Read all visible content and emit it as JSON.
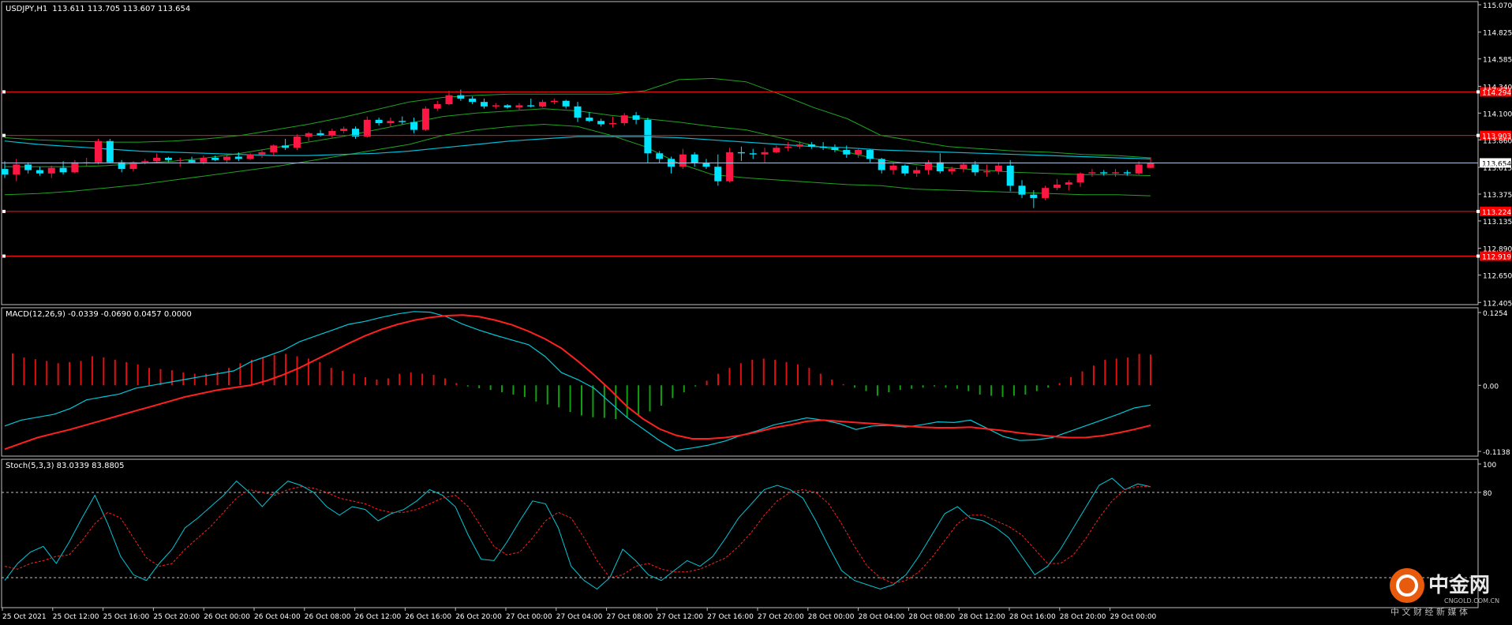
{
  "header": {
    "symbol": "USDJPY,H1",
    "ohlc": "113.611 113.705 113.607 113.654"
  },
  "indicators": {
    "macd_label": "MACD(12,26,9) -0.0339 -0.0690 0.0457 0.0000",
    "stoch_label": "Stoch(5,3,3) 83.0339 83.8805"
  },
  "colors": {
    "background": "#000000",
    "frame": "#c0c0c0",
    "bull_candle": "#ff1744",
    "bear_candle": "#00e5ff",
    "band": "#1fa31f",
    "ma": "#00bcd4",
    "level_line": "#ff1010",
    "price_line": "#b0c4de",
    "macd_main": "#00c8d8",
    "macd_signal": "#ff2020",
    "macd_hist_pos": "#e01010",
    "macd_hist_neg": "#10a010",
    "stoch_main": "#00c8d8",
    "stoch_signal": "#ff2020"
  },
  "chart_data": {
    "type": "candlestick",
    "symbol": "USDJPY",
    "timeframe": "H1",
    "price_axis": {
      "ticks": [
        "115.070",
        "114.825",
        "114.585",
        "114.340",
        "114.100",
        "113.860",
        "113.615",
        "113.375",
        "113.135",
        "112.890",
        "112.650",
        "112.405"
      ],
      "range": [
        112.4,
        115.07
      ],
      "current_price": "113.654"
    },
    "horizontal_levels": [
      {
        "price": 114.29,
        "label": "114.294"
      },
      {
        "price": 113.9,
        "label": "113.903"
      },
      {
        "price": 113.22,
        "label": "113.224"
      },
      {
        "price": 112.82,
        "label": "112.919"
      }
    ],
    "time_axis": [
      "25 Oct 2021",
      "25 Oct 12:00",
      "25 Oct 16:00",
      "25 Oct 20:00",
      "26 Oct 00:00",
      "26 Oct 04:00",
      "26 Oct 08:00",
      "26 Oct 12:00",
      "26 Oct 16:00",
      "26 Oct 20:00",
      "27 Oct 00:00",
      "27 Oct 04:00",
      "27 Oct 08:00",
      "27 Oct 12:00",
      "27 Oct 16:00",
      "27 Oct 20:00",
      "28 Oct 00:00",
      "28 Oct 04:00",
      "28 Oct 08:00",
      "28 Oct 12:00",
      "28 Oct 16:00",
      "28 Oct 20:00",
      "29 Oct 00:00"
    ],
    "candles": [
      [
        113.6,
        113.67,
        113.52,
        113.55
      ],
      [
        113.55,
        113.69,
        113.49,
        113.64
      ],
      [
        113.64,
        113.66,
        113.56,
        113.59
      ],
      [
        113.59,
        113.62,
        113.54,
        113.56
      ],
      [
        113.56,
        113.63,
        113.52,
        113.61
      ],
      [
        113.61,
        113.67,
        113.55,
        113.57
      ],
      [
        113.57,
        113.68,
        113.56,
        113.66
      ],
      [
        113.66,
        113.7,
        113.62,
        113.66
      ],
      [
        113.66,
        113.87,
        113.64,
        113.85
      ],
      [
        113.85,
        113.87,
        113.65,
        113.66
      ],
      [
        113.66,
        113.68,
        113.57,
        113.6
      ],
      [
        113.6,
        113.67,
        113.58,
        113.66
      ],
      [
        113.66,
        113.69,
        113.64,
        113.67
      ],
      [
        113.67,
        113.74,
        113.65,
        113.7
      ],
      [
        113.7,
        113.71,
        113.66,
        113.68
      ],
      [
        113.68,
        113.7,
        113.62,
        113.68
      ],
      [
        113.68,
        113.71,
        113.65,
        113.66
      ],
      [
        113.66,
        113.72,
        113.64,
        113.7
      ],
      [
        113.7,
        113.72,
        113.67,
        113.68
      ],
      [
        113.68,
        113.74,
        113.65,
        113.71
      ],
      [
        113.71,
        113.75,
        113.67,
        113.69
      ],
      [
        113.69,
        113.74,
        113.68,
        113.73
      ],
      [
        113.73,
        113.77,
        113.7,
        113.75
      ],
      [
        113.75,
        113.82,
        113.72,
        113.81
      ],
      [
        113.81,
        113.87,
        113.77,
        113.79
      ],
      [
        113.79,
        113.91,
        113.77,
        113.89
      ],
      [
        113.89,
        113.93,
        113.85,
        113.92
      ],
      [
        113.92,
        113.95,
        113.89,
        113.9
      ],
      [
        113.9,
        113.96,
        113.88,
        113.94
      ],
      [
        113.94,
        113.98,
        113.92,
        113.96
      ],
      [
        113.96,
        113.98,
        113.87,
        113.89
      ],
      [
        113.89,
        114.07,
        113.88,
        114.04
      ],
      [
        114.04,
        114.06,
        113.99,
        114.01
      ],
      [
        114.01,
        114.06,
        113.98,
        114.03
      ],
      [
        114.03,
        114.07,
        114.0,
        114.02
      ],
      [
        114.02,
        114.06,
        113.92,
        113.95
      ],
      [
        113.95,
        114.16,
        113.94,
        114.14
      ],
      [
        114.14,
        114.21,
        114.12,
        114.18
      ],
      [
        114.18,
        114.3,
        114.17,
        114.26
      ],
      [
        114.26,
        114.31,
        114.21,
        114.23
      ],
      [
        114.23,
        114.25,
        114.18,
        114.2
      ],
      [
        114.2,
        114.23,
        114.14,
        114.16
      ],
      [
        114.16,
        114.19,
        114.14,
        114.17
      ],
      [
        114.17,
        114.18,
        114.14,
        114.15
      ],
      [
        114.15,
        114.19,
        114.13,
        114.17
      ],
      [
        114.17,
        114.23,
        114.15,
        114.16
      ],
      [
        114.16,
        114.22,
        114.15,
        114.2
      ],
      [
        114.2,
        114.23,
        114.18,
        114.21
      ],
      [
        114.21,
        114.22,
        114.14,
        114.16
      ],
      [
        114.16,
        114.2,
        114.02,
        114.06
      ],
      [
        114.06,
        114.11,
        114.02,
        114.03
      ],
      [
        114.03,
        114.05,
        113.98,
        114.0
      ],
      [
        114.0,
        114.07,
        113.97,
        114.01
      ],
      [
        114.01,
        114.1,
        113.99,
        114.08
      ],
      [
        114.08,
        114.11,
        114.0,
        114.04
      ],
      [
        114.04,
        114.06,
        113.65,
        113.74
      ],
      [
        113.74,
        113.76,
        113.65,
        113.69
      ],
      [
        113.69,
        113.71,
        113.56,
        113.62
      ],
      [
        113.62,
        113.78,
        113.6,
        113.73
      ],
      [
        113.73,
        113.75,
        113.62,
        113.65
      ],
      [
        113.65,
        113.69,
        113.6,
        113.62
      ],
      [
        113.62,
        113.73,
        113.45,
        113.49
      ],
      [
        113.49,
        113.79,
        113.48,
        113.75
      ],
      [
        113.75,
        113.8,
        113.67,
        113.74
      ],
      [
        113.74,
        113.78,
        113.69,
        113.73
      ],
      [
        113.73,
        113.79,
        113.65,
        113.75
      ],
      [
        113.75,
        113.81,
        113.74,
        113.79
      ],
      [
        113.79,
        113.84,
        113.76,
        113.8
      ],
      [
        113.8,
        113.85,
        113.78,
        113.82
      ],
      [
        113.82,
        113.84,
        113.78,
        113.8
      ],
      [
        113.8,
        113.84,
        113.77,
        113.79
      ],
      [
        113.79,
        113.82,
        113.75,
        113.77
      ],
      [
        113.77,
        113.81,
        113.7,
        113.73
      ],
      [
        113.73,
        113.79,
        113.7,
        113.77
      ],
      [
        113.77,
        113.78,
        113.66,
        113.69
      ],
      [
        113.69,
        113.7,
        113.56,
        113.59
      ],
      [
        113.59,
        113.66,
        113.55,
        113.63
      ],
      [
        113.63,
        113.64,
        113.54,
        113.56
      ],
      [
        113.56,
        113.62,
        113.53,
        113.59
      ],
      [
        113.59,
        113.68,
        113.55,
        113.66
      ],
      [
        113.66,
        113.74,
        113.56,
        113.58
      ],
      [
        113.58,
        113.62,
        113.55,
        113.6
      ],
      [
        113.6,
        113.66,
        113.57,
        113.64
      ],
      [
        113.64,
        113.67,
        113.54,
        113.57
      ],
      [
        113.57,
        113.64,
        113.53,
        113.58
      ],
      [
        113.58,
        113.66,
        113.55,
        113.63
      ],
      [
        113.63,
        113.68,
        113.4,
        113.45
      ],
      [
        113.45,
        113.5,
        113.34,
        113.37
      ],
      [
        113.37,
        113.41,
        113.25,
        113.34
      ],
      [
        113.34,
        113.45,
        113.32,
        113.43
      ],
      [
        113.43,
        113.51,
        113.41,
        113.46
      ],
      [
        113.46,
        113.5,
        113.41,
        113.48
      ],
      [
        113.48,
        113.57,
        113.44,
        113.56
      ],
      [
        113.56,
        113.6,
        113.53,
        113.57
      ],
      [
        113.57,
        113.59,
        113.54,
        113.56
      ],
      [
        113.56,
        113.6,
        113.53,
        113.57
      ],
      [
        113.57,
        113.59,
        113.54,
        113.56
      ],
      [
        113.56,
        113.67,
        113.55,
        113.64
      ],
      [
        113.61,
        113.705,
        113.607,
        113.654
      ]
    ],
    "ma": [
      113.85,
      113.82,
      113.8,
      113.78,
      113.76,
      113.75,
      113.74,
      113.73,
      113.72,
      113.72,
      113.73,
      113.74,
      113.76,
      113.79,
      113.82,
      113.85,
      113.87,
      113.89,
      113.89,
      113.89,
      113.88,
      113.86,
      113.84,
      113.82,
      113.8,
      113.79,
      113.77,
      113.76,
      113.75,
      113.74,
      113.73,
      113.72,
      113.71,
      113.7,
      113.69
    ],
    "band_upper": [
      113.88,
      113.86,
      113.85,
      113.84,
      113.84,
      113.85,
      113.87,
      113.9,
      113.95,
      114.0,
      114.06,
      114.13,
      114.2,
      114.24,
      114.26,
      114.27,
      114.27,
      114.27,
      114.27,
      114.3,
      114.4,
      114.41,
      114.38,
      114.27,
      114.15,
      114.05,
      113.9,
      113.85,
      113.8,
      113.78,
      113.76,
      113.75,
      113.73,
      113.72,
      113.7
    ],
    "band_lower": [
      113.37,
      113.38,
      113.4,
      113.43,
      113.46,
      113.5,
      113.54,
      113.58,
      113.62,
      113.67,
      113.72,
      113.77,
      113.82,
      113.9,
      113.95,
      113.98,
      114.0,
      113.98,
      113.9,
      113.8,
      113.65,
      113.55,
      113.52,
      113.5,
      113.48,
      113.46,
      113.45,
      113.42,
      113.41,
      113.4,
      113.39,
      113.38,
      113.37,
      113.37,
      113.36
    ],
    "band_mid": [
      113.62,
      113.62,
      113.62,
      113.63,
      113.65,
      113.67,
      113.7,
      113.74,
      113.79,
      113.84,
      113.89,
      113.95,
      114.01,
      114.07,
      114.1,
      114.12,
      114.14,
      114.12,
      114.08,
      114.05,
      114.02,
      113.98,
      113.95,
      113.88,
      113.81,
      113.75,
      113.68,
      113.64,
      113.61,
      113.59,
      113.57,
      113.56,
      113.55,
      113.55,
      113.54
    ],
    "macd": {
      "range": [
        -0.1138,
        0.1254
      ],
      "ticks": [
        "0.1254",
        "0.00",
        "-0.1138"
      ],
      "main": [
        -0.07,
        -0.06,
        -0.055,
        -0.05,
        -0.04,
        -0.025,
        -0.02,
        -0.015,
        -0.005,
        0.0,
        0.005,
        0.01,
        0.015,
        0.02,
        0.025,
        0.04,
        0.05,
        0.06,
        0.075,
        0.085,
        0.095,
        0.105,
        0.11,
        0.117,
        0.123,
        0.127,
        0.126,
        0.118,
        0.105,
        0.095,
        0.086,
        0.078,
        0.07,
        0.05,
        0.022,
        0.01,
        -0.005,
        -0.03,
        -0.055,
        -0.075,
        -0.095,
        -0.112,
        -0.108,
        -0.103,
        -0.096,
        -0.086,
        -0.078,
        -0.068,
        -0.062,
        -0.056,
        -0.06,
        -0.066,
        -0.076,
        -0.07,
        -0.069,
        -0.072,
        -0.068,
        -0.063,
        -0.064,
        -0.06,
        -0.074,
        -0.088,
        -0.095,
        -0.094,
        -0.09,
        -0.08,
        -0.07,
        -0.06,
        -0.05,
        -0.039,
        -0.034
      ],
      "signal": [
        -0.11,
        -0.1,
        -0.09,
        -0.083,
        -0.076,
        -0.068,
        -0.06,
        -0.052,
        -0.044,
        -0.036,
        -0.028,
        -0.02,
        -0.014,
        -0.008,
        -0.004,
        0.0,
        0.008,
        0.018,
        0.03,
        0.044,
        0.058,
        0.072,
        0.085,
        0.096,
        0.105,
        0.112,
        0.117,
        0.12,
        0.121,
        0.118,
        0.112,
        0.104,
        0.093,
        0.08,
        0.064,
        0.042,
        0.018,
        -0.008,
        -0.036,
        -0.058,
        -0.075,
        -0.086,
        -0.092,
        -0.092,
        -0.09,
        -0.086,
        -0.08,
        -0.073,
        -0.068,
        -0.062,
        -0.06,
        -0.062,
        -0.064,
        -0.066,
        -0.068,
        -0.07,
        -0.072,
        -0.073,
        -0.073,
        -0.072,
        -0.075,
        -0.078,
        -0.082,
        -0.085,
        -0.088,
        -0.09,
        -0.09,
        -0.087,
        -0.082,
        -0.076,
        -0.069
      ],
      "histogram": [
        0.055,
        0.048,
        0.045,
        0.042,
        0.038,
        0.04,
        0.042,
        0.05,
        0.048,
        0.044,
        0.04,
        0.036,
        0.03,
        0.028,
        0.026,
        0.022,
        0.02,
        0.02,
        0.023,
        0.03,
        0.038,
        0.044,
        0.048,
        0.052,
        0.054,
        0.05,
        0.046,
        0.04,
        0.03,
        0.025,
        0.02,
        0.014,
        0.01,
        0.012,
        0.02,
        0.022,
        0.02,
        0.018,
        0.012,
        0.004,
        -0.002,
        -0.005,
        -0.008,
        -0.012,
        -0.016,
        -0.02,
        -0.028,
        -0.033,
        -0.038,
        -0.046,
        -0.052,
        -0.055,
        -0.056,
        -0.058,
        -0.056,
        -0.052,
        -0.045,
        -0.035,
        -0.022,
        -0.012,
        -0.002,
        0.008,
        0.02,
        0.03,
        0.038,
        0.044,
        0.046,
        0.044,
        0.04,
        0.036,
        0.03,
        0.02,
        0.01,
        0.002,
        -0.004,
        -0.01,
        -0.018,
        -0.012,
        -0.008,
        -0.006,
        -0.004,
        -0.002,
        -0.004,
        -0.006,
        -0.01,
        -0.016,
        -0.018,
        -0.02,
        -0.018,
        -0.016,
        -0.01,
        -0.004,
        0.004,
        0.014,
        0.024,
        0.034,
        0.044,
        0.046,
        0.048,
        0.054,
        0.053
      ]
    },
    "stochastic": {
      "range": [
        0,
        100
      ],
      "levels": [
        "100",
        "80"
      ],
      "main": [
        18,
        30,
        38,
        42,
        30,
        45,
        62,
        78,
        58,
        35,
        22,
        18,
        30,
        40,
        55,
        62,
        70,
        78,
        88,
        80,
        70,
        80,
        88,
        85,
        80,
        70,
        64,
        70,
        68,
        60,
        65,
        68,
        74,
        82,
        78,
        70,
        50,
        33,
        32,
        45,
        60,
        74,
        72,
        55,
        28,
        18,
        12,
        20,
        40,
        32,
        22,
        18,
        25,
        32,
        28,
        35,
        48,
        62,
        72,
        82,
        85,
        82,
        76,
        60,
        42,
        25,
        18,
        15,
        12,
        15,
        22,
        35,
        50,
        65,
        70,
        62,
        60,
        55,
        48,
        35,
        22,
        28,
        40,
        55,
        70,
        85,
        90,
        82,
        86,
        84
      ],
      "signal": [
        28,
        26,
        30,
        32,
        35,
        36,
        46,
        58,
        66,
        62,
        48,
        34,
        28,
        30,
        40,
        48,
        56,
        66,
        76,
        82,
        80,
        78,
        82,
        84,
        83,
        80,
        76,
        74,
        72,
        68,
        66,
        66,
        68,
        72,
        76,
        78,
        70,
        56,
        42,
        36,
        38,
        48,
        60,
        66,
        62,
        48,
        32,
        20,
        22,
        28,
        30,
        26,
        24,
        24,
        26,
        30,
        34,
        42,
        52,
        64,
        74,
        80,
        82,
        80,
        72,
        58,
        42,
        28,
        20,
        16,
        18,
        24,
        34,
        46,
        58,
        64,
        64,
        60,
        56,
        50,
        40,
        30,
        30,
        36,
        48,
        62,
        74,
        82,
        84,
        84
      ]
    }
  },
  "watermark": {
    "brand": "中金网",
    "domain": "CNGOLD.COM.CN",
    "tagline": "中 文 财 经 新 媒 体"
  }
}
